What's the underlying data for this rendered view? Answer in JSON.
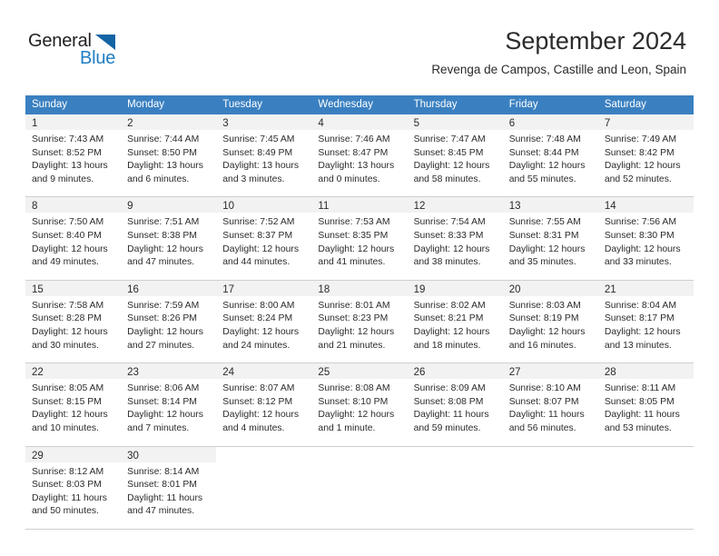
{
  "logo": {
    "word_top": "General",
    "word_bottom": "Blue",
    "triangle_color": "#1464a5",
    "blue_color": "#1f7dc4"
  },
  "header": {
    "title": "September 2024",
    "subtitle": "Revenga de Campos, Castille and Leon, Spain"
  },
  "theme": {
    "header_row_bg": "#3a80c1",
    "daynum_band_bg": "#f2f2f2",
    "row_border": "#cfcfcf",
    "text": "#2b2b2b"
  },
  "weekdays": [
    "Sunday",
    "Monday",
    "Tuesday",
    "Wednesday",
    "Thursday",
    "Friday",
    "Saturday"
  ],
  "labels": {
    "sunrise_prefix": "Sunrise:",
    "sunset_prefix": "Sunset:",
    "daylight_prefix": "Daylight:"
  },
  "weeks": [
    [
      {
        "day": "1",
        "sunrise": "Sunrise: 7:43 AM",
        "sunset": "Sunset: 8:52 PM",
        "daylight_line1": "Daylight: 13 hours",
        "daylight_line2": "and 9 minutes."
      },
      {
        "day": "2",
        "sunrise": "Sunrise: 7:44 AM",
        "sunset": "Sunset: 8:50 PM",
        "daylight_line1": "Daylight: 13 hours",
        "daylight_line2": "and 6 minutes."
      },
      {
        "day": "3",
        "sunrise": "Sunrise: 7:45 AM",
        "sunset": "Sunset: 8:49 PM",
        "daylight_line1": "Daylight: 13 hours",
        "daylight_line2": "and 3 minutes."
      },
      {
        "day": "4",
        "sunrise": "Sunrise: 7:46 AM",
        "sunset": "Sunset: 8:47 PM",
        "daylight_line1": "Daylight: 13 hours",
        "daylight_line2": "and 0 minutes."
      },
      {
        "day": "5",
        "sunrise": "Sunrise: 7:47 AM",
        "sunset": "Sunset: 8:45 PM",
        "daylight_line1": "Daylight: 12 hours",
        "daylight_line2": "and 58 minutes."
      },
      {
        "day": "6",
        "sunrise": "Sunrise: 7:48 AM",
        "sunset": "Sunset: 8:44 PM",
        "daylight_line1": "Daylight: 12 hours",
        "daylight_line2": "and 55 minutes."
      },
      {
        "day": "7",
        "sunrise": "Sunrise: 7:49 AM",
        "sunset": "Sunset: 8:42 PM",
        "daylight_line1": "Daylight: 12 hours",
        "daylight_line2": "and 52 minutes."
      }
    ],
    [
      {
        "day": "8",
        "sunrise": "Sunrise: 7:50 AM",
        "sunset": "Sunset: 8:40 PM",
        "daylight_line1": "Daylight: 12 hours",
        "daylight_line2": "and 49 minutes."
      },
      {
        "day": "9",
        "sunrise": "Sunrise: 7:51 AM",
        "sunset": "Sunset: 8:38 PM",
        "daylight_line1": "Daylight: 12 hours",
        "daylight_line2": "and 47 minutes."
      },
      {
        "day": "10",
        "sunrise": "Sunrise: 7:52 AM",
        "sunset": "Sunset: 8:37 PM",
        "daylight_line1": "Daylight: 12 hours",
        "daylight_line2": "and 44 minutes."
      },
      {
        "day": "11",
        "sunrise": "Sunrise: 7:53 AM",
        "sunset": "Sunset: 8:35 PM",
        "daylight_line1": "Daylight: 12 hours",
        "daylight_line2": "and 41 minutes."
      },
      {
        "day": "12",
        "sunrise": "Sunrise: 7:54 AM",
        "sunset": "Sunset: 8:33 PM",
        "daylight_line1": "Daylight: 12 hours",
        "daylight_line2": "and 38 minutes."
      },
      {
        "day": "13",
        "sunrise": "Sunrise: 7:55 AM",
        "sunset": "Sunset: 8:31 PM",
        "daylight_line1": "Daylight: 12 hours",
        "daylight_line2": "and 35 minutes."
      },
      {
        "day": "14",
        "sunrise": "Sunrise: 7:56 AM",
        "sunset": "Sunset: 8:30 PM",
        "daylight_line1": "Daylight: 12 hours",
        "daylight_line2": "and 33 minutes."
      }
    ],
    [
      {
        "day": "15",
        "sunrise": "Sunrise: 7:58 AM",
        "sunset": "Sunset: 8:28 PM",
        "daylight_line1": "Daylight: 12 hours",
        "daylight_line2": "and 30 minutes."
      },
      {
        "day": "16",
        "sunrise": "Sunrise: 7:59 AM",
        "sunset": "Sunset: 8:26 PM",
        "daylight_line1": "Daylight: 12 hours",
        "daylight_line2": "and 27 minutes."
      },
      {
        "day": "17",
        "sunrise": "Sunrise: 8:00 AM",
        "sunset": "Sunset: 8:24 PM",
        "daylight_line1": "Daylight: 12 hours",
        "daylight_line2": "and 24 minutes."
      },
      {
        "day": "18",
        "sunrise": "Sunrise: 8:01 AM",
        "sunset": "Sunset: 8:23 PM",
        "daylight_line1": "Daylight: 12 hours",
        "daylight_line2": "and 21 minutes."
      },
      {
        "day": "19",
        "sunrise": "Sunrise: 8:02 AM",
        "sunset": "Sunset: 8:21 PM",
        "daylight_line1": "Daylight: 12 hours",
        "daylight_line2": "and 18 minutes."
      },
      {
        "day": "20",
        "sunrise": "Sunrise: 8:03 AM",
        "sunset": "Sunset: 8:19 PM",
        "daylight_line1": "Daylight: 12 hours",
        "daylight_line2": "and 16 minutes."
      },
      {
        "day": "21",
        "sunrise": "Sunrise: 8:04 AM",
        "sunset": "Sunset: 8:17 PM",
        "daylight_line1": "Daylight: 12 hours",
        "daylight_line2": "and 13 minutes."
      }
    ],
    [
      {
        "day": "22",
        "sunrise": "Sunrise: 8:05 AM",
        "sunset": "Sunset: 8:15 PM",
        "daylight_line1": "Daylight: 12 hours",
        "daylight_line2": "and 10 minutes."
      },
      {
        "day": "23",
        "sunrise": "Sunrise: 8:06 AM",
        "sunset": "Sunset: 8:14 PM",
        "daylight_line1": "Daylight: 12 hours",
        "daylight_line2": "and 7 minutes."
      },
      {
        "day": "24",
        "sunrise": "Sunrise: 8:07 AM",
        "sunset": "Sunset: 8:12 PM",
        "daylight_line1": "Daylight: 12 hours",
        "daylight_line2": "and 4 minutes."
      },
      {
        "day": "25",
        "sunrise": "Sunrise: 8:08 AM",
        "sunset": "Sunset: 8:10 PM",
        "daylight_line1": "Daylight: 12 hours",
        "daylight_line2": "and 1 minute."
      },
      {
        "day": "26",
        "sunrise": "Sunrise: 8:09 AM",
        "sunset": "Sunset: 8:08 PM",
        "daylight_line1": "Daylight: 11 hours",
        "daylight_line2": "and 59 minutes."
      },
      {
        "day": "27",
        "sunrise": "Sunrise: 8:10 AM",
        "sunset": "Sunset: 8:07 PM",
        "daylight_line1": "Daylight: 11 hours",
        "daylight_line2": "and 56 minutes."
      },
      {
        "day": "28",
        "sunrise": "Sunrise: 8:11 AM",
        "sunset": "Sunset: 8:05 PM",
        "daylight_line1": "Daylight: 11 hours",
        "daylight_line2": "and 53 minutes."
      }
    ],
    [
      {
        "day": "29",
        "sunrise": "Sunrise: 8:12 AM",
        "sunset": "Sunset: 8:03 PM",
        "daylight_line1": "Daylight: 11 hours",
        "daylight_line2": "and 50 minutes."
      },
      {
        "day": "30",
        "sunrise": "Sunrise: 8:14 AM",
        "sunset": "Sunset: 8:01 PM",
        "daylight_line1": "Daylight: 11 hours",
        "daylight_line2": "and 47 minutes."
      },
      {
        "day": "",
        "sunrise": "",
        "sunset": "",
        "daylight_line1": "",
        "daylight_line2": ""
      },
      {
        "day": "",
        "sunrise": "",
        "sunset": "",
        "daylight_line1": "",
        "daylight_line2": ""
      },
      {
        "day": "",
        "sunrise": "",
        "sunset": "",
        "daylight_line1": "",
        "daylight_line2": ""
      },
      {
        "day": "",
        "sunrise": "",
        "sunset": "",
        "daylight_line1": "",
        "daylight_line2": ""
      },
      {
        "day": "",
        "sunrise": "",
        "sunset": "",
        "daylight_line1": "",
        "daylight_line2": ""
      }
    ]
  ]
}
